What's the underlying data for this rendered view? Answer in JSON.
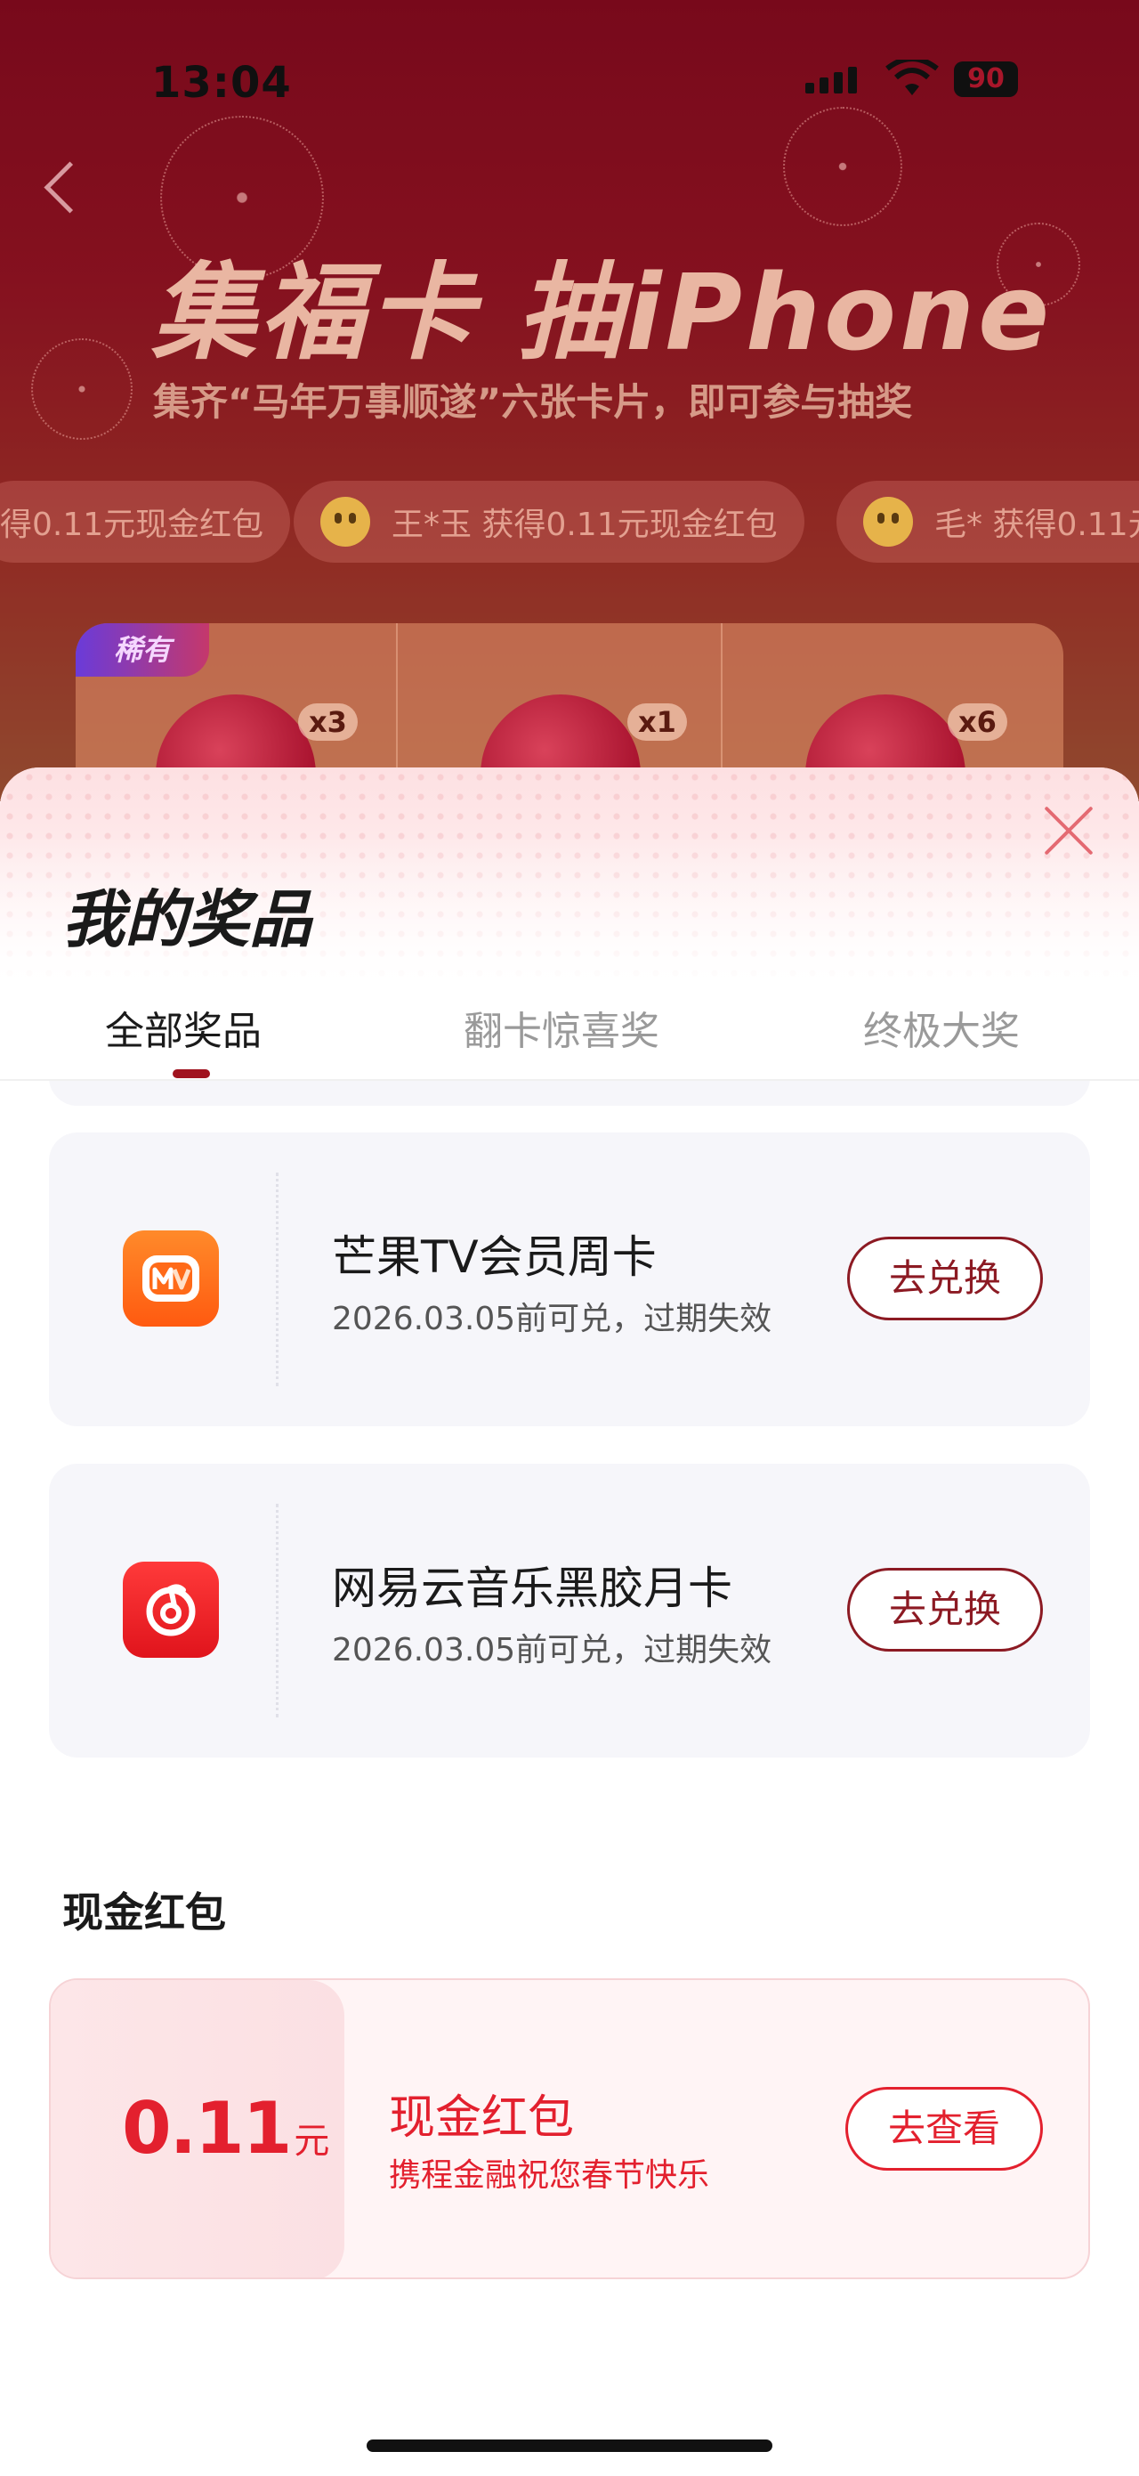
{
  "status_bar": {
    "time": "13:04",
    "battery": "90"
  },
  "hero": {
    "title": "集福卡 抽iPhone",
    "subtitle": "集齐“马年万事顺遂”六张卡片，即可参与抽奖"
  },
  "ticker": [
    "得0.11元现金红包",
    "王*玉 获得0.11元现金红包",
    "毛* 获得0.11元"
  ],
  "cards": {
    "rare_tag": "稀有",
    "counts": [
      "x3",
      "x1",
      "x6"
    ]
  },
  "sheet": {
    "title": "我的奖品",
    "tabs": [
      {
        "label": "全部奖品",
        "active": true
      },
      {
        "label": "翻卡惊喜奖",
        "active": false
      },
      {
        "label": "终极大奖",
        "active": false
      }
    ],
    "prizes": [
      {
        "name": "芒果TV会员周卡",
        "expiry": "2026.03.05前可兑，过期失效",
        "action": "去兑换",
        "icon": "mango-tv-icon"
      },
      {
        "name": "网易云音乐黑胶月卡",
        "expiry": "2026.03.05前可兑，过期失效",
        "action": "去兑换",
        "icon": "netease-music-icon"
      }
    ],
    "cash_section": {
      "label": "现金红包",
      "amount": "0.11",
      "unit": "元",
      "title": "现金红包",
      "subtitle": "携程金融祝您春节快乐",
      "action": "去查看"
    }
  },
  "colors": {
    "brand_dark_red": "#8c1a23",
    "cash_red": "#e3202e",
    "tab_indicator": "#a0121e"
  }
}
